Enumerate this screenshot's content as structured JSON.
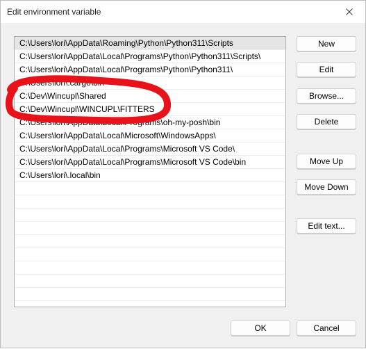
{
  "window": {
    "title": "Edit environment variable"
  },
  "paths": [
    "C:\\Users\\lori\\AppData\\Roaming\\Python\\Python311\\Scripts",
    "C:\\Users\\lori\\AppData\\Local\\Programs\\Python\\Python311\\Scripts\\",
    "C:\\Users\\lori\\AppData\\Local\\Programs\\Python\\Python311\\",
    "C:\\Users\\lori\\.cargo\\bin",
    "C:\\Dev\\Wincupl\\Shared",
    "C:\\Dev\\Wincupl\\WINCUPL\\FITTERS",
    "C:\\Users\\lori\\AppData\\Local\\Programs\\oh-my-posh\\bin",
    "C:\\Users\\lori\\AppData\\Local\\Microsoft\\WindowsApps\\",
    "C:\\Users\\lori\\AppData\\Local\\Programs\\Microsoft VS Code\\",
    "C:\\Users\\lori\\AppData\\Local\\Programs\\Microsoft VS Code\\bin",
    "C:\\Users\\lori\\.local\\bin",
    "",
    "",
    "",
    "",
    "",
    "",
    "",
    "",
    ""
  ],
  "buttons": {
    "new": "New",
    "edit": "Edit",
    "browse": "Browse...",
    "delete": "Delete",
    "move_up": "Move Up",
    "move_down": "Move Down",
    "edit_text": "Edit text...",
    "ok": "OK",
    "cancel": "Cancel"
  },
  "colors": {
    "annotation": "#e8121b",
    "selected_row": "#e5e5e5"
  },
  "icons": {
    "close": "close-icon"
  }
}
